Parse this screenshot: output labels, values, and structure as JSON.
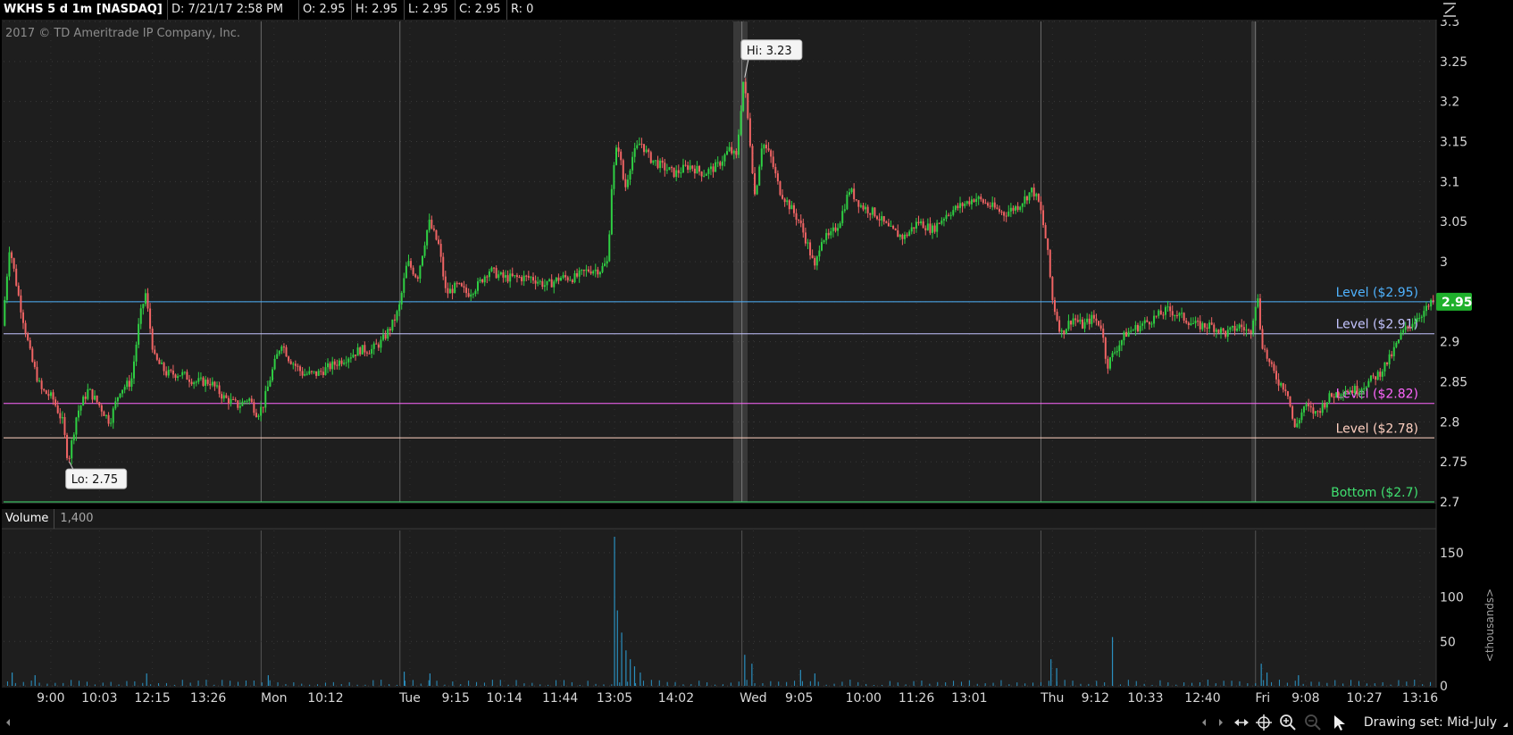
{
  "header": {
    "symbol": "WKHS 5 d 1m [NASDAQ]",
    "date": "D: 7/21/17 2:58 PM",
    "open": "O: 2.95",
    "high": "H: 2.95",
    "low": "L: 2.95",
    "close": "C: 2.95",
    "range": "R: 0"
  },
  "copyright": "2017 © TD Ameritrade IP Company, Inc.",
  "colors": {
    "background": "#1e1e1e",
    "up": "#2fcf43",
    "down": "#f06464",
    "volume": "#2a8fbf",
    "price_badge": "#1fb02c"
  },
  "volume_panel": {
    "label": "Volume",
    "value": "1,400",
    "unit_label": "<thousands>"
  },
  "bottom_bar": {
    "drawing_set": "Drawing set: Mid-July"
  },
  "chart_data": {
    "type": "candlestick",
    "title": "WKHS 5 d 1m [NASDAQ]",
    "interval": "1m",
    "grid": true,
    "ylim": [
      2.7,
      3.3
    ],
    "y_ticks": [
      2.7,
      2.75,
      2.8,
      2.85,
      2.9,
      2.95,
      3,
      3.05,
      3.1,
      3.15,
      3.2,
      3.25,
      3.3
    ],
    "y_tick_labels": [
      "2.7",
      "2.75",
      "2.8",
      "2.85",
      "2.9",
      "2.95",
      "3",
      "3.05",
      "3.1",
      "3.15",
      "3.2",
      "3.25",
      "3.3"
    ],
    "current_price": 2.95,
    "current_price_label": "2.95",
    "x_ticks": [
      {
        "label": "9:00",
        "pos": 0.033
      },
      {
        "label": "10:03",
        "pos": 0.067
      },
      {
        "label": "12:15",
        "pos": 0.104
      },
      {
        "label": "13:26",
        "pos": 0.143
      },
      {
        "label": "Mon",
        "pos": 0.189
      },
      {
        "label": "10:12",
        "pos": 0.225
      },
      {
        "label": "Tue",
        "pos": 0.284
      },
      {
        "label": "9:15",
        "pos": 0.316
      },
      {
        "label": "10:14",
        "pos": 0.35
      },
      {
        "label": "11:44",
        "pos": 0.389
      },
      {
        "label": "13:05",
        "pos": 0.427
      },
      {
        "label": "14:02",
        "pos": 0.47
      },
      {
        "label": "Wed",
        "pos": 0.524
      },
      {
        "label": "9:05",
        "pos": 0.556
      },
      {
        "label": "10:00",
        "pos": 0.601
      },
      {
        "label": "11:26",
        "pos": 0.638
      },
      {
        "label": "13:01",
        "pos": 0.675
      },
      {
        "label": "Thu",
        "pos": 0.733
      },
      {
        "label": "9:12",
        "pos": 0.763
      },
      {
        "label": "10:33",
        "pos": 0.798
      },
      {
        "label": "12:40",
        "pos": 0.838
      },
      {
        "label": "Fri",
        "pos": 0.88
      },
      {
        "label": "9:08",
        "pos": 0.91
      },
      {
        "label": "10:27",
        "pos": 0.951
      },
      {
        "label": "13:16",
        "pos": 0.99
      }
    ],
    "session_breaks": [
      0.18,
      0.277,
      0.516,
      0.725,
      0.875
    ],
    "levels": [
      {
        "label": "Level ($2.95)",
        "value": 2.95,
        "color": "#4fb3ff"
      },
      {
        "label": "Level ($2.91)",
        "value": 2.91,
        "color": "#c4c4ff"
      },
      {
        "label": "Level ($2.82)",
        "value": 2.823,
        "color": "#ff66ff"
      },
      {
        "label": "Level ($2.78)",
        "value": 2.78,
        "color": "#ffd0c0"
      },
      {
        "label": "Bottom ($2.7)",
        "value": 2.7,
        "color": "#40e070"
      }
    ],
    "annotations": [
      {
        "label": "Hi: 3.23",
        "value": 3.23,
        "pos": 0.518
      },
      {
        "label": "Lo: 2.75",
        "value": 2.75,
        "pos": 0.046
      }
    ],
    "price_path": [
      [
        0.0,
        2.92
      ],
      [
        0.005,
        3.02
      ],
      [
        0.012,
        2.95
      ],
      [
        0.02,
        2.88
      ],
      [
        0.027,
        2.84
      ],
      [
        0.035,
        2.83
      ],
      [
        0.042,
        2.8
      ],
      [
        0.046,
        2.75
      ],
      [
        0.052,
        2.81
      ],
      [
        0.06,
        2.84
      ],
      [
        0.068,
        2.82
      ],
      [
        0.075,
        2.8
      ],
      [
        0.082,
        2.84
      ],
      [
        0.09,
        2.85
      ],
      [
        0.096,
        2.93
      ],
      [
        0.1,
        2.96
      ],
      [
        0.106,
        2.88
      ],
      [
        0.115,
        2.86
      ],
      [
        0.125,
        2.86
      ],
      [
        0.135,
        2.85
      ],
      [
        0.145,
        2.85
      ],
      [
        0.155,
        2.83
      ],
      [
        0.165,
        2.82
      ],
      [
        0.172,
        2.83
      ],
      [
        0.178,
        2.81
      ],
      [
        0.182,
        2.82
      ],
      [
        0.188,
        2.86
      ],
      [
        0.195,
        2.9
      ],
      [
        0.2,
        2.88
      ],
      [
        0.21,
        2.86
      ],
      [
        0.22,
        2.86
      ],
      [
        0.23,
        2.87
      ],
      [
        0.24,
        2.88
      ],
      [
        0.25,
        2.89
      ],
      [
        0.258,
        2.89
      ],
      [
        0.265,
        2.9
      ],
      [
        0.272,
        2.92
      ],
      [
        0.277,
        2.94
      ],
      [
        0.283,
        3.0
      ],
      [
        0.29,
        2.98
      ],
      [
        0.298,
        3.05
      ],
      [
        0.305,
        3.02
      ],
      [
        0.31,
        2.96
      ],
      [
        0.318,
        2.97
      ],
      [
        0.325,
        2.96
      ],
      [
        0.332,
        2.97
      ],
      [
        0.34,
        2.99
      ],
      [
        0.35,
        2.98
      ],
      [
        0.36,
        2.98
      ],
      [
        0.37,
        2.98
      ],
      [
        0.38,
        2.97
      ],
      [
        0.39,
        2.98
      ],
      [
        0.4,
        2.98
      ],
      [
        0.41,
        2.99
      ],
      [
        0.418,
        2.99
      ],
      [
        0.423,
        3.0
      ],
      [
        0.426,
        3.1
      ],
      [
        0.43,
        3.15
      ],
      [
        0.435,
        3.09
      ],
      [
        0.44,
        3.13
      ],
      [
        0.446,
        3.15
      ],
      [
        0.452,
        3.13
      ],
      [
        0.46,
        3.12
      ],
      [
        0.47,
        3.11
      ],
      [
        0.48,
        3.12
      ],
      [
        0.49,
        3.11
      ],
      [
        0.5,
        3.12
      ],
      [
        0.508,
        3.14
      ],
      [
        0.513,
        3.13
      ],
      [
        0.518,
        3.23
      ],
      [
        0.522,
        3.16
      ],
      [
        0.526,
        3.08
      ],
      [
        0.531,
        3.15
      ],
      [
        0.537,
        3.13
      ],
      [
        0.543,
        3.09
      ],
      [
        0.55,
        3.07
      ],
      [
        0.557,
        3.05
      ],
      [
        0.563,
        3.02
      ],
      [
        0.568,
        2.99
      ],
      [
        0.572,
        3.03
      ],
      [
        0.578,
        3.03
      ],
      [
        0.585,
        3.05
      ],
      [
        0.592,
        3.09
      ],
      [
        0.6,
        3.07
      ],
      [
        0.61,
        3.06
      ],
      [
        0.62,
        3.04
      ],
      [
        0.63,
        3.03
      ],
      [
        0.64,
        3.05
      ],
      [
        0.65,
        3.04
      ],
      [
        0.66,
        3.06
      ],
      [
        0.67,
        3.07
      ],
      [
        0.68,
        3.08
      ],
      [
        0.69,
        3.07
      ],
      [
        0.7,
        3.06
      ],
      [
        0.71,
        3.07
      ],
      [
        0.72,
        3.09
      ],
      [
        0.725,
        3.07
      ],
      [
        0.73,
        3.02
      ],
      [
        0.734,
        2.95
      ],
      [
        0.74,
        2.91
      ],
      [
        0.748,
        2.93
      ],
      [
        0.755,
        2.92
      ],
      [
        0.762,
        2.93
      ],
      [
        0.768,
        2.92
      ],
      [
        0.772,
        2.87
      ],
      [
        0.778,
        2.89
      ],
      [
        0.785,
        2.91
      ],
      [
        0.795,
        2.92
      ],
      [
        0.805,
        2.93
      ],
      [
        0.815,
        2.94
      ],
      [
        0.825,
        2.93
      ],
      [
        0.835,
        2.92
      ],
      [
        0.845,
        2.92
      ],
      [
        0.855,
        2.91
      ],
      [
        0.865,
        2.92
      ],
      [
        0.872,
        2.91
      ],
      [
        0.877,
        2.96
      ],
      [
        0.88,
        2.9
      ],
      [
        0.886,
        2.87
      ],
      [
        0.892,
        2.85
      ],
      [
        0.898,
        2.84
      ],
      [
        0.903,
        2.79
      ],
      [
        0.91,
        2.82
      ],
      [
        0.918,
        2.81
      ],
      [
        0.927,
        2.83
      ],
      [
        0.937,
        2.84
      ],
      [
        0.947,
        2.84
      ],
      [
        0.955,
        2.85
      ],
      [
        0.962,
        2.86
      ],
      [
        0.97,
        2.88
      ],
      [
        0.978,
        2.91
      ],
      [
        0.988,
        2.93
      ],
      [
        0.995,
        2.94
      ],
      [
        1.0,
        2.95
      ]
    ],
    "volume_axis": {
      "ylim": [
        0,
        175
      ],
      "ticks": [
        0,
        50,
        100,
        150
      ],
      "tick_labels": [
        "0",
        "50",
        "100",
        "150"
      ]
    },
    "volume_spikes": [
      {
        "pos": 0.427,
        "value": 168
      },
      {
        "pos": 0.429,
        "value": 85
      },
      {
        "pos": 0.432,
        "value": 60
      },
      {
        "pos": 0.435,
        "value": 40
      },
      {
        "pos": 0.438,
        "value": 30
      },
      {
        "pos": 0.441,
        "value": 22
      },
      {
        "pos": 0.445,
        "value": 15
      },
      {
        "pos": 0.518,
        "value": 35
      },
      {
        "pos": 0.523,
        "value": 25
      },
      {
        "pos": 0.557,
        "value": 18
      },
      {
        "pos": 0.567,
        "value": 14
      },
      {
        "pos": 0.732,
        "value": 30
      },
      {
        "pos": 0.736,
        "value": 20
      },
      {
        "pos": 0.775,
        "value": 55
      },
      {
        "pos": 0.879,
        "value": 25
      },
      {
        "pos": 0.883,
        "value": 15
      },
      {
        "pos": 0.905,
        "value": 12
      },
      {
        "pos": 0.006,
        "value": 15
      },
      {
        "pos": 0.022,
        "value": 12
      },
      {
        "pos": 0.1,
        "value": 14
      },
      {
        "pos": 0.185,
        "value": 12
      },
      {
        "pos": 0.28,
        "value": 16
      },
      {
        "pos": 0.298,
        "value": 14
      }
    ]
  }
}
